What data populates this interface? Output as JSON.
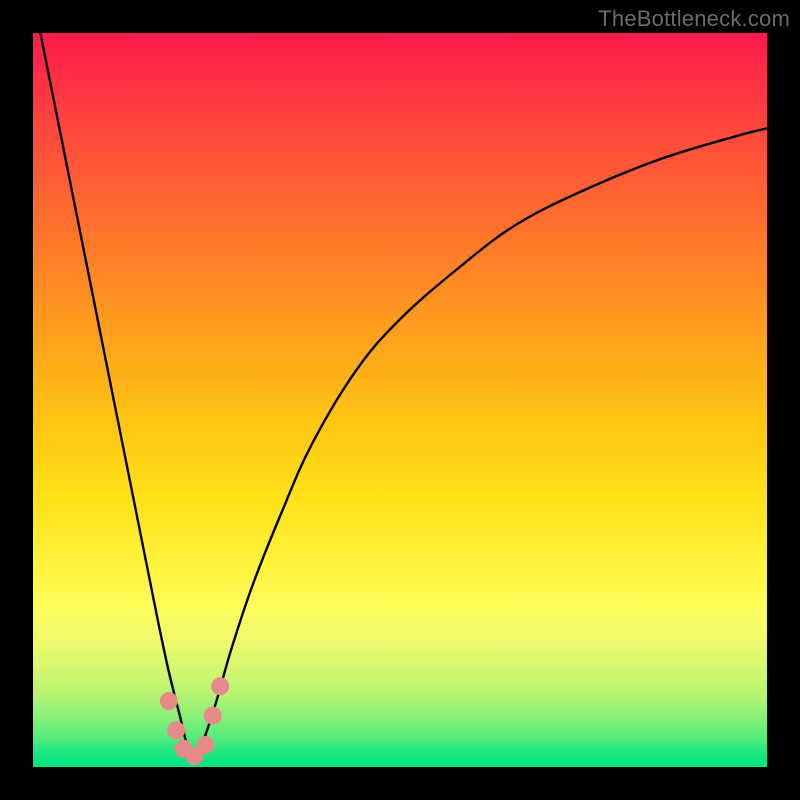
{
  "watermark": "TheBottleneck.com",
  "colors": {
    "frame": "#000000",
    "curve": "#000000",
    "marker_fill": "#e78a8a",
    "gradient_top": "#ff1a4d",
    "gradient_bottom": "#00e47e"
  },
  "chart_data": {
    "type": "line",
    "title": "",
    "xlabel": "",
    "ylabel": "",
    "x_range": [
      0,
      100
    ],
    "y_range": [
      0,
      100
    ],
    "description": "Bottleneck-style V-shaped curve on a vertical red-to-green gradient. Two black curves descend from the top: a steep left branch from the top-left corner and a shallower right branch from near the top-right, both meeting in a narrow trough near the bottom at roughly x≈22. Pink dot markers cluster around the trough.",
    "series": [
      {
        "name": "left_branch",
        "x": [
          1,
          3,
          5,
          7,
          9,
          11,
          13,
          15,
          17,
          18.5,
          20,
          21,
          22
        ],
        "y": [
          100,
          90,
          80,
          70,
          60,
          50,
          40,
          30,
          20,
          13,
          7,
          3,
          1
        ]
      },
      {
        "name": "right_branch",
        "x": [
          22,
          23,
          25,
          27,
          30,
          34,
          38,
          44,
          50,
          58,
          66,
          76,
          86,
          96,
          100
        ],
        "y": [
          1,
          3,
          9,
          16,
          25,
          35,
          44,
          54,
          61,
          68,
          74,
          79,
          83,
          86,
          87
        ]
      }
    ],
    "markers": [
      {
        "x": 18.5,
        "y": 9
      },
      {
        "x": 19.5,
        "y": 5
      },
      {
        "x": 20.5,
        "y": 2.5
      },
      {
        "x": 22,
        "y": 1.5
      },
      {
        "x": 23.5,
        "y": 3
      },
      {
        "x": 24.5,
        "y": 7
      },
      {
        "x": 25.5,
        "y": 11
      }
    ]
  }
}
